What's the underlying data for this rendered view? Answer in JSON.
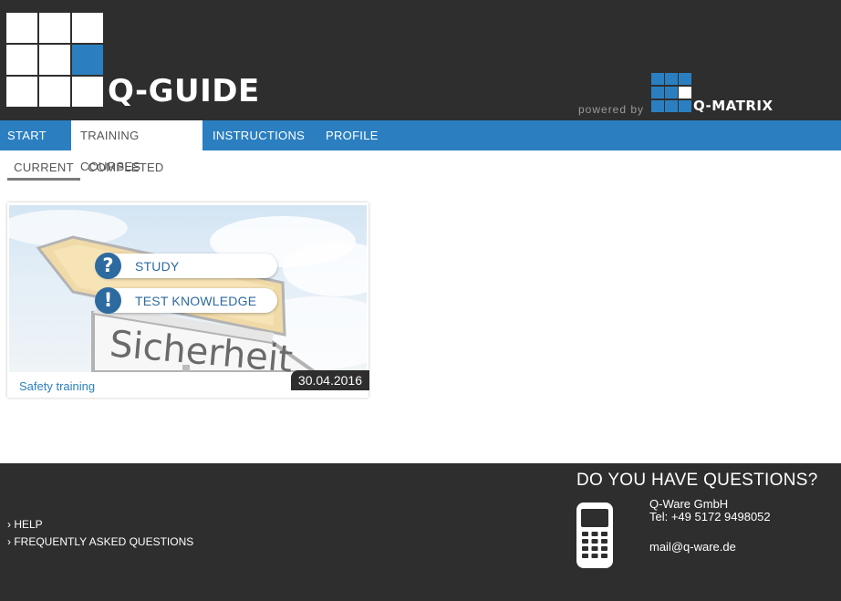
{
  "header": {
    "logo_text": "Q-GUIDE",
    "powered_by": "powered by",
    "partner_logo_text": "Q-MATRIX"
  },
  "nav": {
    "items": [
      {
        "label": "START",
        "active": false
      },
      {
        "label": "TRAINING COURSES",
        "active": true
      },
      {
        "label": "INSTRUCTIONS",
        "active": false
      },
      {
        "label": "PROFILE",
        "active": false
      }
    ]
  },
  "subtabs": [
    {
      "label": "CURRENT",
      "active": true
    },
    {
      "label": "COMPLETED",
      "active": false
    }
  ],
  "course": {
    "image_sign_text": "Sicherheit",
    "actions": [
      {
        "icon": "question-icon",
        "glyph": "?",
        "label": "STUDY"
      },
      {
        "icon": "exclamation-icon",
        "glyph": "!",
        "label": "TEST KNOWLEDGE"
      }
    ],
    "name": "Safety training",
    "date": "30.04.2016"
  },
  "footer": {
    "links": [
      {
        "label": "› HELP"
      },
      {
        "label": "› FREQUENTLY ASKED QUESTIONS"
      }
    ],
    "questions_heading": "DO YOU HAVE QUESTIONS?",
    "company": "Q-Ware GmbH",
    "phone": "Tel: +49 5172 9498052",
    "email": "mail@q-ware.de"
  },
  "colors": {
    "accent": "#2b7fc0",
    "dark": "#2e2e2e",
    "icon_blue": "#2d6aa0"
  }
}
